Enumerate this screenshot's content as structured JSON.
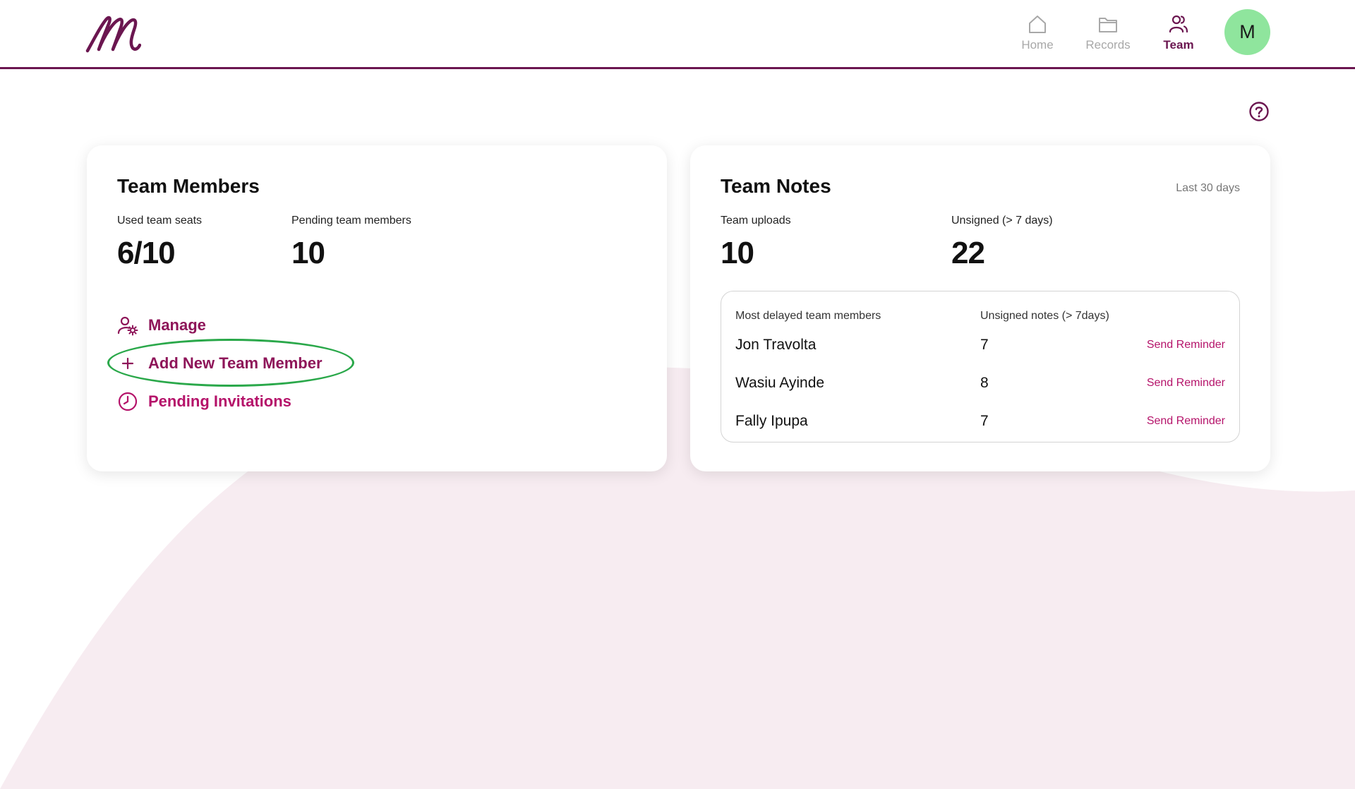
{
  "header": {
    "logo_letter": "m",
    "nav": [
      {
        "label": "Home",
        "icon": "home-icon",
        "active": false
      },
      {
        "label": "Records",
        "icon": "folder-icon",
        "active": false
      },
      {
        "label": "Team",
        "icon": "team-icon",
        "active": true
      }
    ],
    "avatar_initial": "M"
  },
  "colors": {
    "brand": "#6b1650",
    "accent": "#b5136a",
    "avatar_bg": "#8fe59d",
    "highlight": "#2aa84a",
    "background_wave": "#f7ecf1"
  },
  "team_members": {
    "title": "Team Members",
    "used_seats_label": "Used team seats",
    "used_seats_value": "6/10",
    "pending_label": "Pending team members",
    "pending_value": "10",
    "actions": {
      "manage": "Manage",
      "add": "Add New Team Member",
      "pending": "Pending Invitations"
    }
  },
  "team_notes": {
    "title": "Team Notes",
    "range": "Last 30 days",
    "uploads_label": "Team uploads",
    "uploads_value": "10",
    "unsigned_label": "Unsigned (> 7 days)",
    "unsigned_value": "22",
    "table": {
      "col_name": "Most delayed team members",
      "col_count": "Unsigned notes (> 7days)",
      "rows": [
        {
          "name": "Jon Travolta",
          "count": "7",
          "action": "Send Reminder"
        },
        {
          "name": "Wasiu Ayinde",
          "count": "8",
          "action": "Send Reminder"
        },
        {
          "name": "Fally Ipupa",
          "count": "7",
          "action": "Send Reminder"
        }
      ]
    }
  }
}
